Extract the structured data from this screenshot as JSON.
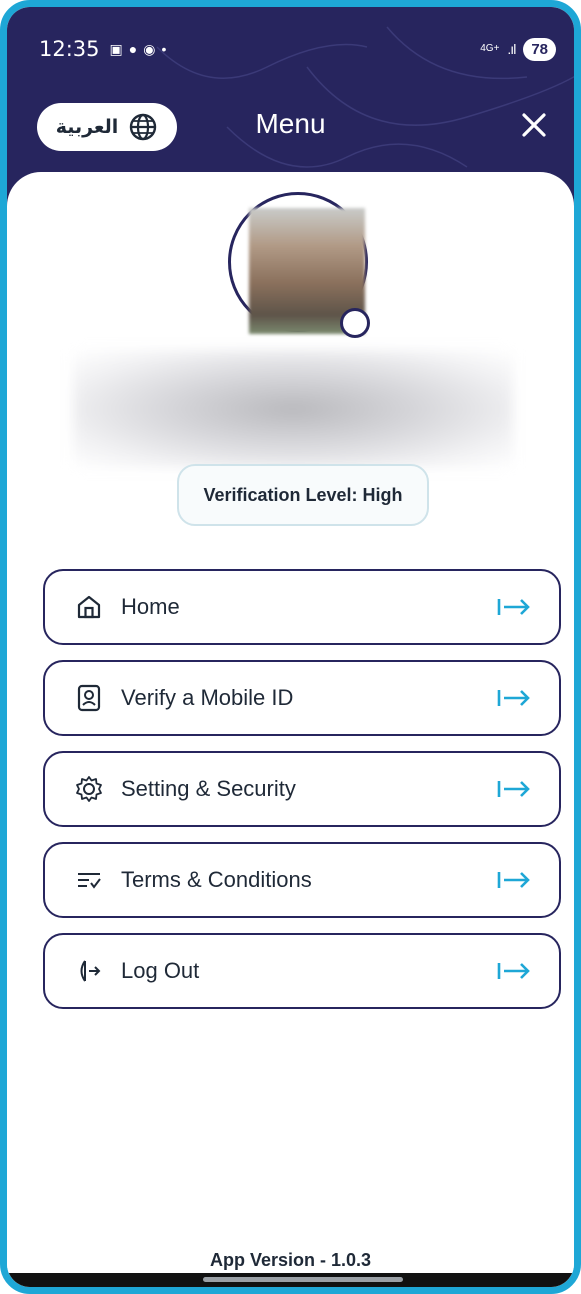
{
  "status_bar": {
    "time": "12:35",
    "network": "4G+",
    "battery": "78"
  },
  "header": {
    "language_button_label": "العربية",
    "title": "Menu"
  },
  "profile": {
    "verification_label": "Verification Level: High"
  },
  "menu": {
    "items": [
      {
        "label": "Home",
        "icon": "home-icon"
      },
      {
        "label": "Verify a Mobile ID",
        "icon": "id-badge-icon"
      },
      {
        "label": "Setting & Security",
        "icon": "gear-icon"
      },
      {
        "label": "Terms & Conditions",
        "icon": "list-check-icon"
      },
      {
        "label": "Log Out",
        "icon": "logout-icon"
      }
    ]
  },
  "footer": {
    "app_version": "App Version - 1.0.3"
  },
  "colors": {
    "header_bg": "#27255e",
    "frame_border": "#1ea7d6",
    "arrow_accent": "#1ea7d6",
    "text": "#1f2937"
  }
}
